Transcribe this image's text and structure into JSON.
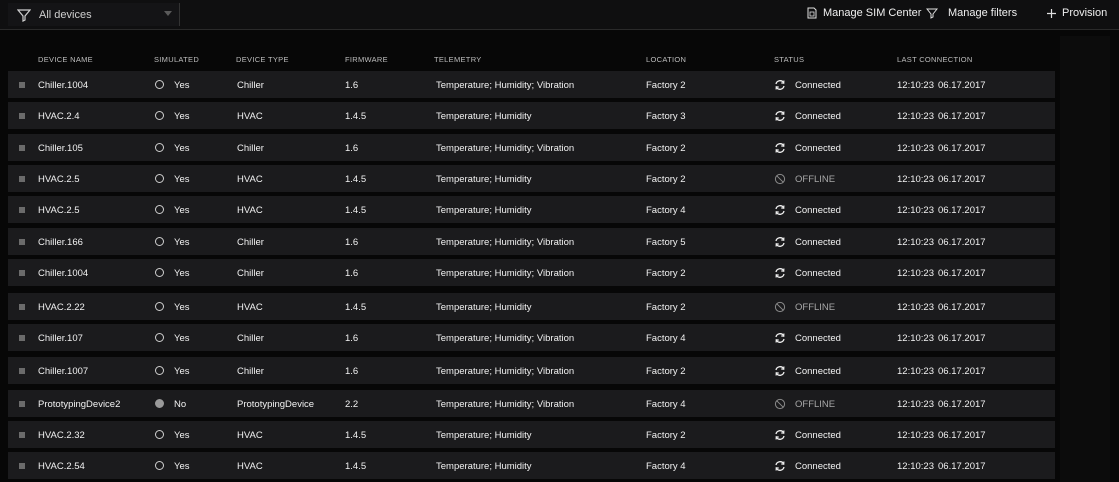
{
  "toolbar": {
    "filter_value": "All devices",
    "manage_sim_label": "Manage SIM Center",
    "manage_filters_label": "Manage filters",
    "provision_label": "Provision"
  },
  "columns": {
    "device_name": "DEVICE NAME",
    "simulated": "SIMULATED",
    "device_type": "DEVICE TYPE",
    "firmware": "FIRMWARE",
    "telemetry": "TELEMETRY",
    "location": "LOCATION",
    "status": "STATUS",
    "last_connection": "LAST CONNECTION"
  },
  "rows": [
    {
      "name": "Chiller.1004",
      "simulated": "Yes",
      "type": "Chiller",
      "firmware": "1.6",
      "telemetry": "Temperature; Humidity; Vibration",
      "location": "Factory 2",
      "status": "Connected",
      "time": "12:10:23",
      "date": "06.17.2017"
    },
    {
      "name": "HVAC.2.4",
      "simulated": "Yes",
      "type": "HVAC",
      "firmware": "1.4.5",
      "telemetry": "Temperature; Humidity",
      "location": "Factory 3",
      "status": "Connected",
      "time": "12:10:23",
      "date": "06.17.2017"
    },
    {
      "name": "Chiller.105",
      "simulated": "Yes",
      "type": "Chiller",
      "firmware": "1.6",
      "telemetry": "Temperature; Humidity; Vibration",
      "location": "Factory 2",
      "status": "Connected",
      "time": "12:10:23",
      "date": "06.17.2017"
    },
    {
      "name": "HVAC.2.5",
      "simulated": "Yes",
      "type": "HVAC",
      "firmware": "1.4.5",
      "telemetry": "Temperature; Humidity",
      "location": "Factory 2",
      "status": "OFFLINE",
      "time": "12:10:23",
      "date": "06.17.2017"
    },
    {
      "name": "HVAC.2.5",
      "simulated": "Yes",
      "type": "HVAC",
      "firmware": "1.4.5",
      "telemetry": "Temperature; Humidity",
      "location": "Factory 4",
      "status": "Connected",
      "time": "12:10:23",
      "date": "06.17.2017"
    },
    {
      "name": "Chiller.166",
      "simulated": "Yes",
      "type": "Chiller",
      "firmware": "1.6",
      "telemetry": "Temperature; Humidity; Vibration",
      "location": "Factory 5",
      "status": "Connected",
      "time": "12:10:23",
      "date": "06.17.2017"
    },
    {
      "name": "Chiller.1004",
      "simulated": "Yes",
      "type": "Chiller",
      "firmware": "1.6",
      "telemetry": "Temperature; Humidity; Vibration",
      "location": "Factory 2",
      "status": "Connected",
      "time": "12:10:23",
      "date": "06.17.2017"
    },
    {
      "name": "HVAC.2.22",
      "simulated": "Yes",
      "type": "HVAC",
      "firmware": "1.4.5",
      "telemetry": "Temperature; Humidity",
      "location": "Factory 2",
      "status": "OFFLINE",
      "time": "12:10:23",
      "date": "06.17.2017"
    },
    {
      "name": "Chiller.107",
      "simulated": "Yes",
      "type": "Chiller",
      "firmware": "1.6",
      "telemetry": "Temperature; Humidity; Vibration",
      "location": "Factory 4",
      "status": "Connected",
      "time": "12:10:23",
      "date": "06.17.2017"
    },
    {
      "name": "Chiller.1007",
      "simulated": "Yes",
      "type": "Chiller",
      "firmware": "1.6",
      "telemetry": "Temperature; Humidity; Vibration",
      "location": "Factory 2",
      "status": "Connected",
      "time": "12:10:23",
      "date": "06.17.2017"
    },
    {
      "name": "PrototypingDevice2",
      "simulated": "No",
      "type": "PrototypingDevice",
      "firmware": "2.2",
      "telemetry": "Temperature; Humidity; Vibration",
      "location": "Factory 4",
      "status": "OFFLINE",
      "time": "12:10:23",
      "date": "06.17.2017"
    },
    {
      "name": "HVAC.2.32",
      "simulated": "Yes",
      "type": "HVAC",
      "firmware": "1.4.5",
      "telemetry": "Temperature; Humidity",
      "location": "Factory 2",
      "status": "Connected",
      "time": "12:10:23",
      "date": "06.17.2017"
    },
    {
      "name": "HVAC.2.54",
      "simulated": "Yes",
      "type": "HVAC",
      "firmware": "1.4.5",
      "telemetry": "Temperature; Humidity",
      "location": "Factory 4",
      "status": "Connected",
      "time": "12:10:23",
      "date": "06.17.2017"
    }
  ],
  "icons": {
    "filter": "filter-icon",
    "chevron": "chevron-down-icon",
    "sim_center": "sim-card-icon",
    "manage_filters": "filter-icon",
    "provision": "plus-icon",
    "connected": "sync-icon",
    "offline": "offline-icon"
  }
}
